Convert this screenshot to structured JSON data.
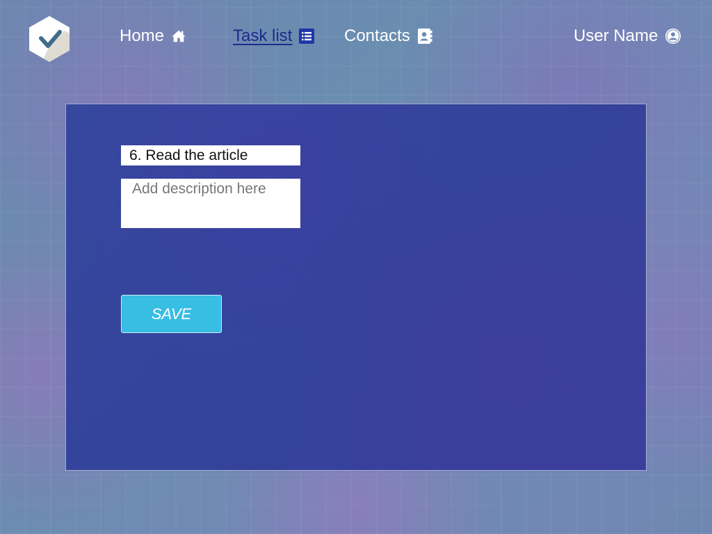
{
  "nav": {
    "home": {
      "label": "Home",
      "icon": "home-icon"
    },
    "tasks": {
      "label": "Task list",
      "icon": "list-icon",
      "active": true
    },
    "contacts": {
      "label": "Contacts",
      "icon": "address-book-icon"
    },
    "user": {
      "label": "User Name",
      "icon": "user-circle-icon"
    }
  },
  "logo": {
    "icon": "checkmark-hexagon-icon"
  },
  "form": {
    "title_value": "6. Read the article",
    "description_placeholder": "Add description here",
    "save_label": "SAVE"
  },
  "colors": {
    "active_nav": "#1a2c8a",
    "panel": "#36479e",
    "save_button": "#38bde3",
    "icon_badge": "#1f35a8"
  }
}
